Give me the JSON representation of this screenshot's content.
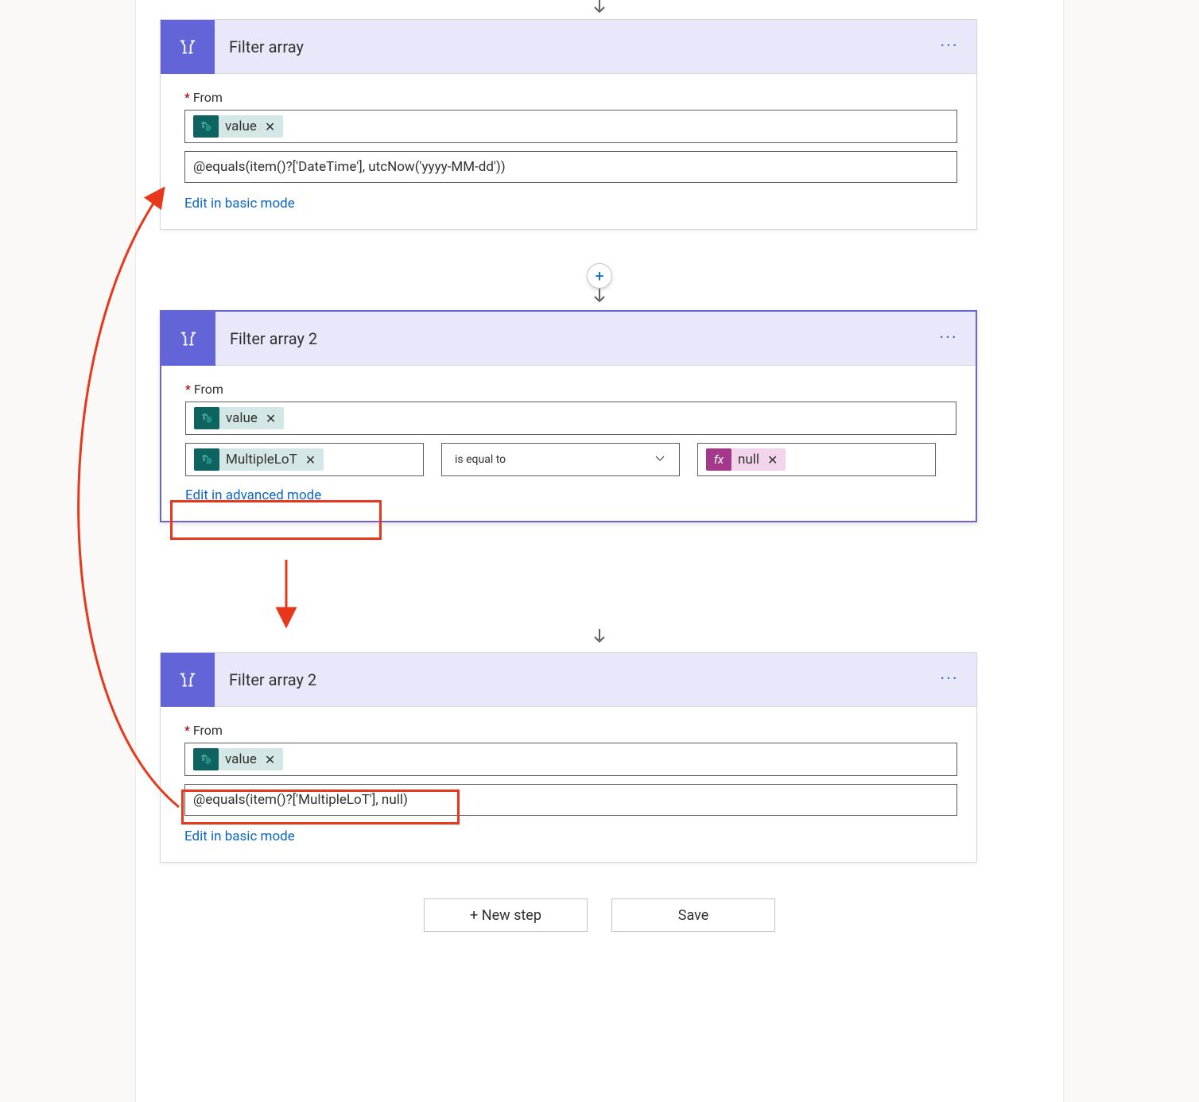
{
  "cards": {
    "c1": {
      "title": "Filter array",
      "from_label": "From",
      "from_pill": "value",
      "expression": "@equals(item()?['DateTime'], utcNow('yyyy-MM-dd'))",
      "link": "Edit in basic mode"
    },
    "c2": {
      "title": "Filter array 2",
      "from_label": "From",
      "from_pill": "value",
      "cond_left_pill": "MultipleLoT",
      "cond_op": "is equal to",
      "cond_right_pill": "null",
      "link": "Edit in advanced mode"
    },
    "c3": {
      "title": "Filter array 2",
      "from_label": "From",
      "from_pill": "value",
      "expression": "@equals(item()?['MultipleLoT'], null)",
      "link": "Edit in basic mode"
    }
  },
  "footer": {
    "new_step": "+ New step",
    "save": "Save"
  },
  "glyphs": {
    "fx": "fx"
  }
}
